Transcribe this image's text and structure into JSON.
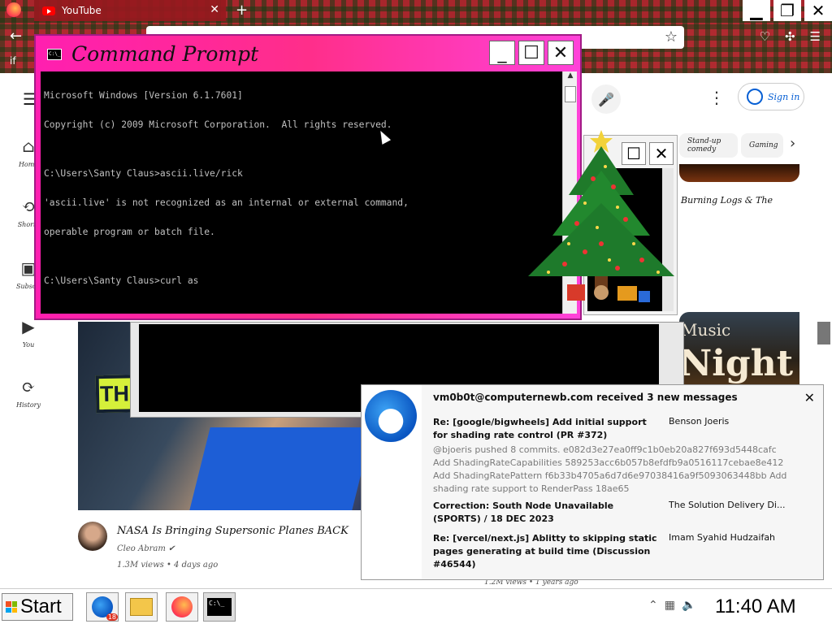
{
  "browser": {
    "tab_title": "YouTube",
    "tab_close": "✕",
    "new_tab": "+",
    "bookmark_label": "if",
    "win_min": "▁",
    "win_restore": "❐",
    "win_close": "✕"
  },
  "youtube": {
    "sidebar": [
      {
        "label": "Home",
        "icon": "home-icon",
        "glyph": "⌂"
      },
      {
        "label": "Shorts",
        "icon": "shorts-icon",
        "glyph": "⟲"
      },
      {
        "label": "Subscriptions",
        "icon": "subscriptions-icon",
        "glyph": "▣"
      },
      {
        "label": "You",
        "icon": "you-icon",
        "glyph": "▶"
      },
      {
        "label": "History",
        "icon": "history-icon",
        "glyph": "⟳"
      }
    ],
    "signin_label": "Sign in",
    "chips": [
      "Stand-up comedy",
      "Gaming"
    ],
    "right_video_title": "Burning Logs & The",
    "music_thumb_line1": "Music",
    "music_thumb_line2": "Night",
    "thumbnail_text": "THEY SOLVED IT?",
    "video_title": "NASA Is Bringing Supersonic Planes BACK",
    "channel": "Cleo Abram",
    "meta": "1.3M views • 4 days ago",
    "bottom_meta": "1.2M views • 1 years ago"
  },
  "cmd": {
    "title": "Command Prompt",
    "icon_text": "C:\\_",
    "min": "_",
    "max": "☐",
    "close": "✕",
    "lines": [
      "Microsoft Windows [Version 6.1.7601]",
      "Copyright (c) 2009 Microsoft Corporation.  All rights reserved.",
      "",
      "C:\\Users\\Santy Claus>ascii.live/rick",
      "'ascii.live' is not recognized as an internal or external command,",
      "operable program or batch file.",
      "",
      "C:\\Users\\Santy Claus>curl as"
    ]
  },
  "notification": {
    "header": "vm0b0t@computernewb.com received 3 new messages",
    "close": "✕",
    "messages": [
      {
        "subject": "Re: [google/bigwheels] Add initial support for shading rate control (PR #372)",
        "sender": "Benson Joeris"
      },
      {
        "subject": "Correction: South Node Unavailable (SPORTS) / 18 DEC 2023",
        "sender": "The Solution Delivery Di..."
      },
      {
        "subject": "Re: [vercel/next.js] Ablitty to skipping static pages generating at build time (Discussion #46544)",
        "sender": "Imam Syahid Hudzaifah"
      }
    ],
    "preview": "@bjoeris pushed 8 commits. e082d3e27ea0ff9c1b0eb20a827f693d5448cafc Add ShadingRateCapabilities 589253acc6b057b8efdfb9a0516117cebae8e412 Add ShadingRatePattern f6b33b4705a6d7d6e97038416a9f5093063448bb Add shading rate support to RenderPass 18ae65"
  },
  "taskbar": {
    "start_label": "Start",
    "thunderbird_badge": "18",
    "cmd_label": "C:\\_",
    "clock": "11:40 AM"
  }
}
